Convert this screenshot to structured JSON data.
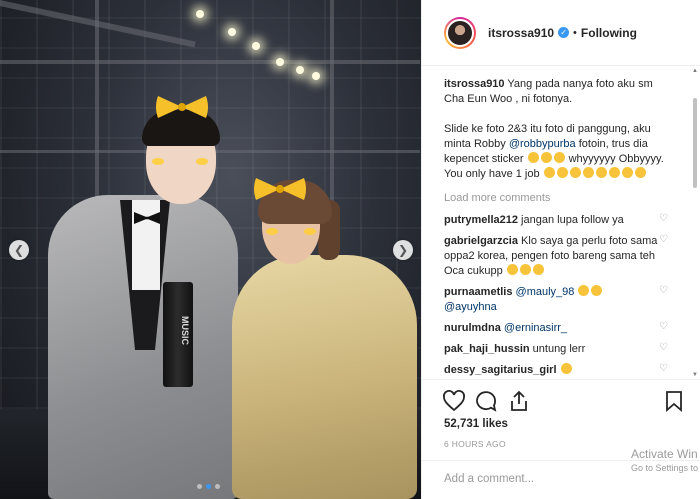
{
  "post": {
    "username": "itsrossa910",
    "follow_status": "Following",
    "separator": "•",
    "caption": {
      "username": "itsrossa910",
      "line1": "Yang pada nanya foto aku sm Cha Eun Woo , ni fotonya.",
      "line2a": "Slide ke foto 2&3 itu foto di panggung, aku minta Robby",
      "line2_mention": "@robbypurba",
      "line2b": "fotoin, trus dia kepencet sticker",
      "line2c": "whyyyyyy Obbyyyy. You only have 1 job"
    },
    "load_more": "Load more comments",
    "comments": [
      {
        "username": "putrymella212",
        "text": "jangan lupa follow ya"
      },
      {
        "username": "gabrielgarzcia",
        "text": "Klo saya ga perlu foto sama oppa2 korea, pengen foto bareng sama teh Oca cukupp"
      },
      {
        "username": "purnaametlis",
        "mention": "@mauly_98",
        "mention2": "@ayuyhna"
      },
      {
        "username": "nurulmdna",
        "mention": "@erninasirr_"
      },
      {
        "username": "pak_haji_hussin",
        "text": "untung lerr"
      },
      {
        "username": "dessy_sagitarius_girl",
        "text": ""
      }
    ],
    "likes": "52,731 likes",
    "time": "6 HOURS AGO",
    "add_comment_placeholder": "Add a comment...",
    "photo_trophy_text": "MUSIC"
  },
  "icons": {
    "heart": "heart-icon",
    "comment": "comment-icon",
    "share": "share-icon",
    "bookmark": "bookmark-icon"
  },
  "watermark": {
    "line1": "Activate Win",
    "line2": "Go to Settings to"
  },
  "colors": {
    "accent": "#3897f0",
    "muted": "#999999",
    "mention": "#003569"
  }
}
